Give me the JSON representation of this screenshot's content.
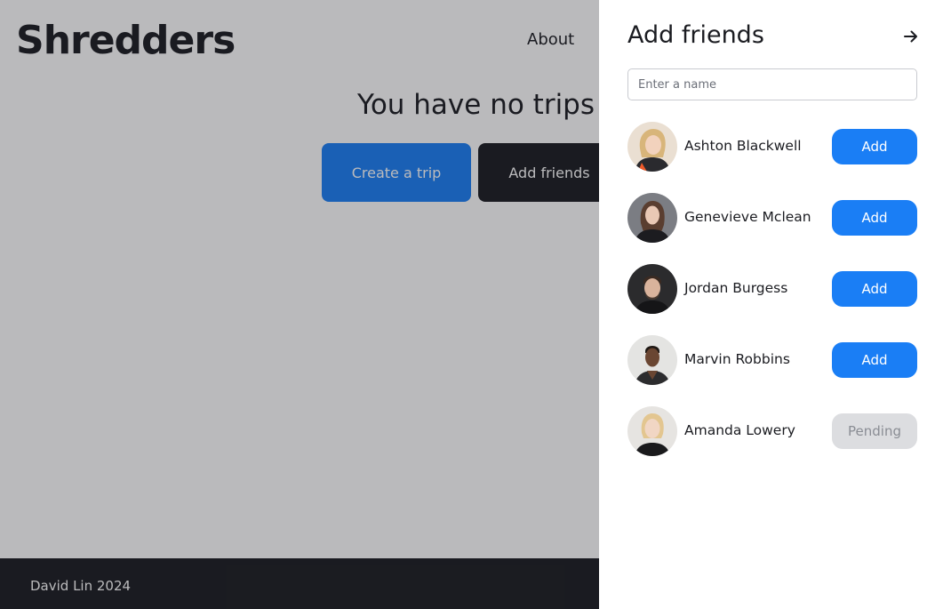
{
  "header": {
    "brand": "Shredders",
    "nav_about": "About"
  },
  "main": {
    "empty_title": "You have no trips",
    "create_trip_label": "Create a trip",
    "add_friends_label": "Add friends"
  },
  "footer": {
    "text": "David Lin 2024"
  },
  "drawer": {
    "title": "Add friends",
    "close_icon": "arrow-right-icon",
    "search_placeholder": "Enter a name",
    "search_value": "",
    "friends": [
      {
        "name": "Ashton Blackwell",
        "action": "Add",
        "status": "add"
      },
      {
        "name": "Genevieve Mclean",
        "action": "Add",
        "status": "add"
      },
      {
        "name": "Jordan Burgess",
        "action": "Add",
        "status": "add"
      },
      {
        "name": "Marvin Robbins",
        "action": "Add",
        "status": "add"
      },
      {
        "name": "Amanda Lowery",
        "action": "Pending",
        "status": "pending"
      }
    ]
  },
  "colors": {
    "accent": "#1a7ef5",
    "dark": "#1b1c21",
    "pending_bg": "#dcdde0",
    "pending_text": "#8a8d94"
  }
}
